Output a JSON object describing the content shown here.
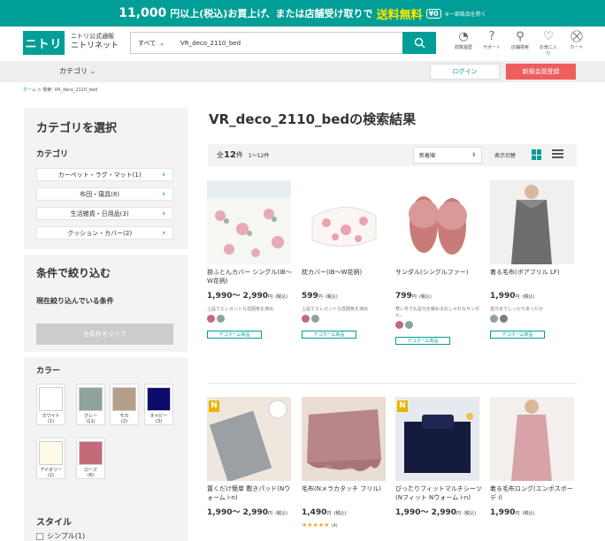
{
  "banner": {
    "amount": "11,000",
    "text1": "円以上(税込)お買上げ、または店舗受け取りで",
    "highlight": "送料無料",
    "chip": "¥0",
    "small": "※一部商品を除く"
  },
  "header": {
    "logo": "ニトリ",
    "logo_sub1": "ニトリ公式通販",
    "logo_sub2": "ニトリネット",
    "search_scope": "すべて",
    "search_query": "VR_deco_2110_bed",
    "icons": [
      {
        "name": "history-icon",
        "label": "閲覧履歴",
        "glyph": "◔"
      },
      {
        "name": "support-icon",
        "label": "サポート",
        "glyph": "?"
      },
      {
        "name": "store-icon",
        "label": "店舗検索",
        "glyph": "⚲"
      },
      {
        "name": "favorite-icon",
        "label": "お気に入り",
        "glyph": "♡"
      },
      {
        "name": "cart-icon",
        "label": "カート",
        "glyph": "⛒"
      }
    ]
  },
  "nav": {
    "category": "カテゴリ",
    "login": "ログイン",
    "register": "新規会員登録"
  },
  "breadcrumb": {
    "home": "ホーム",
    "sep": ">",
    "current": "検索: VR_deco_2110_bed"
  },
  "sidebar": {
    "title": "カテゴリを選択",
    "category_label": "カテゴリ",
    "categories": [
      {
        "label": "カーペット・ラグ・マット(1)"
      },
      {
        "label": "布団・寝具(8)"
      },
      {
        "label": "生活雑貨・日用品(3)"
      },
      {
        "label": "クッション・カバー(2)"
      }
    ],
    "filter_title": "条件で絞り込む",
    "current_filter": "現在絞り込んでいる条件",
    "clear_all": "全条件をクリア",
    "color_label": "カラー",
    "colors": [
      {
        "name": "ホワイト",
        "count": "(1)",
        "hex": "#ffffff"
      },
      {
        "name": "グレー",
        "count": "(11)",
        "hex": "#8fa39d"
      },
      {
        "name": "モカ",
        "count": "(2)",
        "hex": "#b4a08a"
      },
      {
        "name": "ネイビー",
        "count": "(3)",
        "hex": "#0d0a6e"
      },
      {
        "name": "アイボリー",
        "count": "(2)",
        "hex": "#fdfbe8"
      },
      {
        "name": "ローズ",
        "count": "(8)",
        "hex": "#c46a78"
      }
    ],
    "style_label": "スタイル",
    "style_option": "シンプル(1)"
  },
  "main": {
    "title": "VR_deco_2110_bedの検索結果",
    "count_prefix": "全",
    "count": "12",
    "count_suffix": "件",
    "range": "1〜12件",
    "sort": "新着順",
    "display_label": "表示切替"
  },
  "products": [
    {
      "name": "掛ふとんカバー シングル(IB～W花柄)",
      "price": "1,990～ 2,990",
      "unit": "円",
      "tax": "(税込)",
      "desc": "上品でエレガントな雰囲気を演出",
      "dots": [
        "#c46a78",
        "#8fa39d"
      ],
      "tag": "デコホーム商品",
      "stars": "",
      "reviews": ""
    },
    {
      "name": "枕カバー(IB～W花柄)",
      "price": "599",
      "unit": "円",
      "tax": "(税込)",
      "desc": "上品でエレガントな雰囲気を演出",
      "dots": [
        "#c46a78",
        "#8fa39d"
      ],
      "tag": "デコホーム商品",
      "stars": "",
      "reviews": ""
    },
    {
      "name": "サンダル(シングルファー)",
      "price": "799",
      "unit": "円",
      "tax": "(税込)",
      "desc": "寒い冬でも足元を暖めるおしゃれなサンダル。",
      "dots": [
        "#c46a78",
        "#8fa39d"
      ],
      "tag": "デコホーム商品",
      "stars": "",
      "reviews": ""
    },
    {
      "name": "着る毛布(ボアフリル LF)",
      "price": "1,990",
      "unit": "円",
      "tax": "(税込)",
      "desc": "首元までしっかりあったか",
      "dots": [
        "#8fa39d",
        "#7d7d7d"
      ],
      "tag": "デコホーム商品",
      "stars": "",
      "reviews": ""
    },
    {
      "name": "置くだけ簡単 敷きパッド(Nウォーム i-n)",
      "price": "1,990～ 2,990",
      "unit": "円",
      "tax": "(税込)",
      "desc": "",
      "dots": [],
      "tag": "",
      "stars": "",
      "reviews": ""
    },
    {
      "name": "毛布(Nメラカタッチ フリル)",
      "price": "1,490",
      "unit": "円",
      "tax": "(税込)",
      "desc": "",
      "dots": [],
      "tag": "",
      "stars": "★★★★★",
      "reviews": "(4)"
    },
    {
      "name": "ぴったりフィットマルチシーツ(Nフィット Nウォーム i-n)",
      "price": "1,990～ 2,990",
      "unit": "円",
      "tax": "(税込)",
      "desc": "",
      "dots": [],
      "tag": "",
      "stars": "",
      "reviews": ""
    },
    {
      "name": "着る毛布ロング(エンボスボーデ i)",
      "price": "1,990",
      "unit": "円",
      "tax": "(税込)",
      "desc": "",
      "dots": [],
      "tag": "",
      "stars": "",
      "reviews": ""
    }
  ]
}
